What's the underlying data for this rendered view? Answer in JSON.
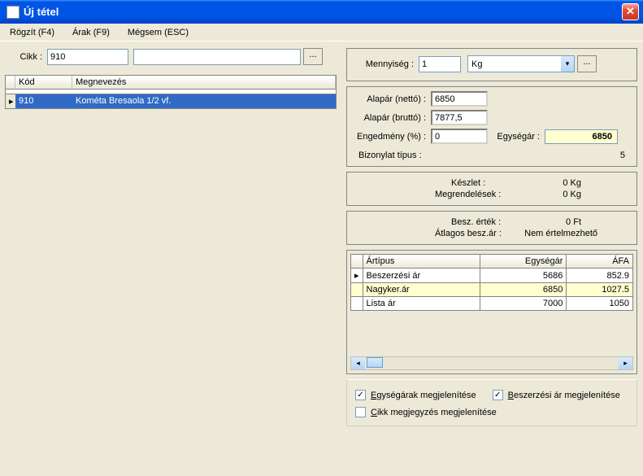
{
  "window": {
    "title": "Új tétel"
  },
  "menu": {
    "rogzit": "Rögzít (F4)",
    "arak": "Árak (F9)",
    "megsem": "Mégsem (ESC)"
  },
  "cikk": {
    "label": "Cikk :",
    "code": "910",
    "name": "",
    "browse": "..."
  },
  "grid": {
    "headers": {
      "kod": "Kód",
      "megnevezes": "Megnevezés"
    },
    "rows": [
      {
        "kod": "910",
        "megnevezes": "Kométa Bresaola 1/2 vf."
      }
    ]
  },
  "qty": {
    "label": "Mennyiség :",
    "value": "1",
    "unit": "Kg",
    "browse": "..."
  },
  "prices": {
    "alapar_netto_label": "Alapár (nettó) :",
    "alapar_netto": "6850",
    "alapar_brutto_label": "Alapár (bruttó) :",
    "alapar_brutto": "7877,5",
    "engedmeny_label": "Engedmény (%) :",
    "engedmeny": "0",
    "egysegar_label": "Egységár :",
    "egysegar": "6850",
    "bizonylat_label": "Bizonylat típus :",
    "bizonylat": "5"
  },
  "stock": {
    "keszlet_label": "Készlet :",
    "keszlet": "0 Kg",
    "megrend_label": "Megrendelések :",
    "megrend": "0 Kg"
  },
  "purchase": {
    "ertek_label": "Besz. érték :",
    "ertek": "0 Ft",
    "atlag_label": "Átlagos besz.ár :",
    "atlag": "Nem értelmezhető"
  },
  "price_table": {
    "headers": {
      "artipus": "Ártípus",
      "egysegar": "Egységár",
      "afa": "ÁFA"
    },
    "rows": [
      {
        "artipus": "Beszerzési ár",
        "egysegar": "5686",
        "afa": "852.9"
      },
      {
        "artipus": "Nagyker.ár",
        "egysegar": "6850",
        "afa": "1027.5"
      },
      {
        "artipus": "Lista ár",
        "egysegar": "7000",
        "afa": "1050"
      }
    ]
  },
  "checks": {
    "egysegarak": "Egységárak megjelenítése",
    "beszerzesi": "Beszerzési ár megjelenítése",
    "cikkmegj": "Cikk megjegyzés megjelenítése"
  }
}
